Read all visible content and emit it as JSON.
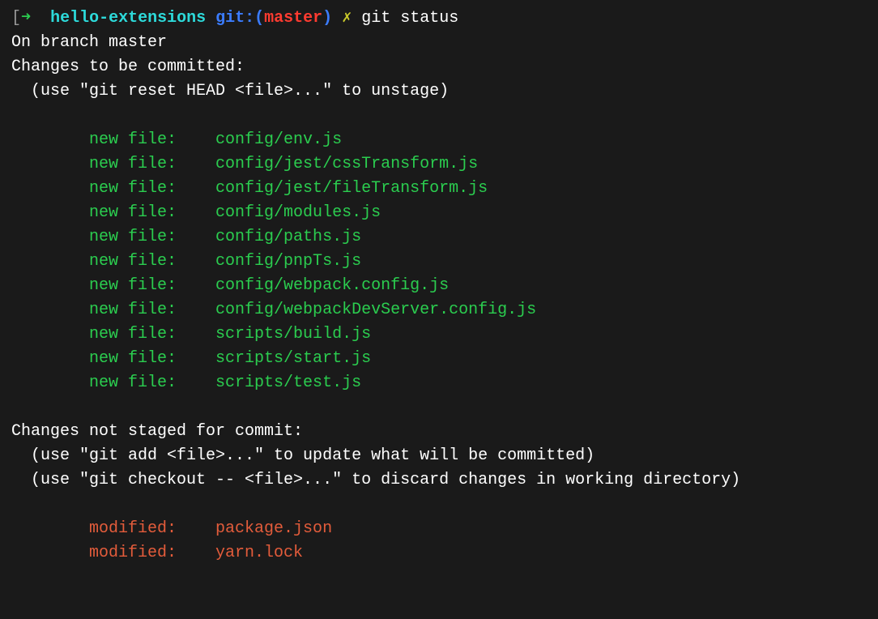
{
  "prompt": {
    "bracket_open": "[",
    "arrow": "➜",
    "dirname": "hello-extensions",
    "git_label": "git:",
    "paren_open": "(",
    "branch": "master",
    "paren_close": ")",
    "lightning": "✗",
    "command": "git status"
  },
  "status": {
    "branch_line": "On branch master",
    "staged_header": "Changes to be committed:",
    "staged_hint": "  (use \"git reset HEAD <file>...\" to unstage)",
    "unstaged_header": "Changes not staged for commit:",
    "unstaged_hint1": "  (use \"git add <file>...\" to update what will be committed)",
    "unstaged_hint2": "  (use \"git checkout -- <file>...\" to discard changes in working directory)"
  },
  "staged_files": [
    {
      "status": "new file:",
      "path": "config/env.js"
    },
    {
      "status": "new file:",
      "path": "config/jest/cssTransform.js"
    },
    {
      "status": "new file:",
      "path": "config/jest/fileTransform.js"
    },
    {
      "status": "new file:",
      "path": "config/modules.js"
    },
    {
      "status": "new file:",
      "path": "config/paths.js"
    },
    {
      "status": "new file:",
      "path": "config/pnpTs.js"
    },
    {
      "status": "new file:",
      "path": "config/webpack.config.js"
    },
    {
      "status": "new file:",
      "path": "config/webpackDevServer.config.js"
    },
    {
      "status": "new file:",
      "path": "scripts/build.js"
    },
    {
      "status": "new file:",
      "path": "scripts/start.js"
    },
    {
      "status": "new file:",
      "path": "scripts/test.js"
    }
  ],
  "unstaged_files": [
    {
      "status": "modified:",
      "path": "package.json"
    },
    {
      "status": "modified:",
      "path": "yarn.lock"
    }
  ]
}
